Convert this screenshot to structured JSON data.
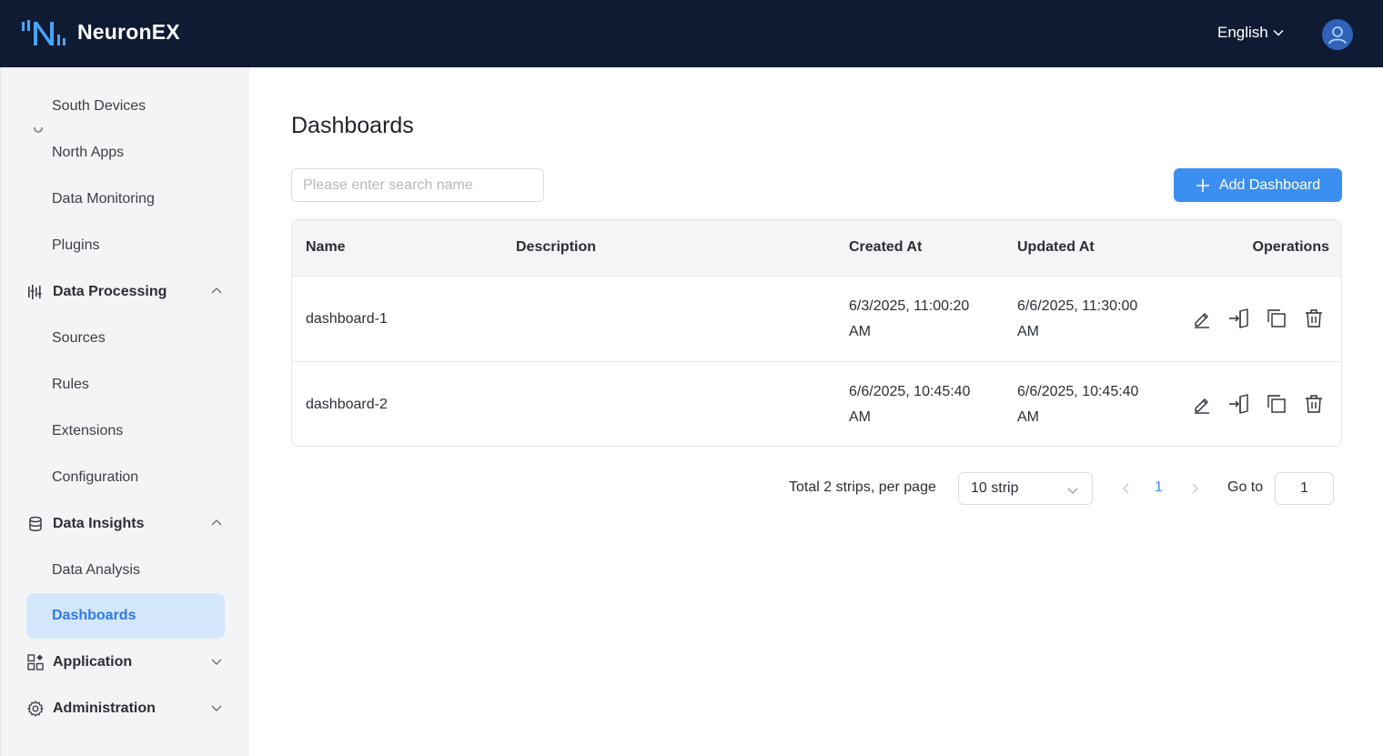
{
  "header": {
    "brand": "NeuronEX",
    "language": "English"
  },
  "sidebar": {
    "items": [
      {
        "label": "South Devices",
        "type": "sub"
      },
      {
        "label": "North Apps",
        "type": "sub"
      },
      {
        "label": "Data Monitoring",
        "type": "sub"
      },
      {
        "label": "Plugins",
        "type": "sub"
      },
      {
        "label": "Data Processing",
        "type": "group",
        "icon": "data-processing-icon",
        "expanded": true
      },
      {
        "label": "Sources",
        "type": "sub"
      },
      {
        "label": "Rules",
        "type": "sub"
      },
      {
        "label": "Extensions",
        "type": "sub"
      },
      {
        "label": "Configuration",
        "type": "sub"
      },
      {
        "label": "Data Insights",
        "type": "group",
        "icon": "database-icon",
        "expanded": true
      },
      {
        "label": "Data Analysis",
        "type": "sub"
      },
      {
        "label": "Dashboards",
        "type": "sub",
        "active": true
      },
      {
        "label": "Application",
        "type": "group",
        "icon": "application-grid-icon",
        "expanded": false
      },
      {
        "label": "Administration",
        "type": "group",
        "icon": "settings-gear-icon",
        "expanded": false
      }
    ]
  },
  "main": {
    "title": "Dashboards",
    "search_placeholder": "Please enter search name",
    "search_value": "",
    "add_button": "Add Dashboard"
  },
  "table": {
    "columns": [
      "Name",
      "Description",
      "Created At",
      "Updated At",
      "Operations"
    ],
    "rows": [
      {
        "name": "dashboard-1",
        "description": "",
        "created_line1": "6/3/2025, 11:00:20",
        "created_line2": "AM",
        "updated_line1": "6/6/2025, 11:30:00",
        "updated_line2": "AM"
      },
      {
        "name": "dashboard-2",
        "description": "",
        "created_line1": "6/6/2025, 10:45:40",
        "created_line2": "AM",
        "updated_line1": "6/6/2025, 10:45:40",
        "updated_line2": "AM"
      }
    ],
    "operations": [
      "edit-icon",
      "export-icon",
      "copy-icon",
      "delete-icon"
    ]
  },
  "pagination": {
    "total_text": "Total 2 strips, per page",
    "page_size": "10 strip",
    "current_page": "1",
    "goto_label": "Go to",
    "goto_value": "1"
  },
  "colors": {
    "header_bg": "#0f1b33",
    "accent": "#3b8ff0",
    "active_bg": "#d3e6fb",
    "sidebar_bg": "#f3f4f6"
  }
}
